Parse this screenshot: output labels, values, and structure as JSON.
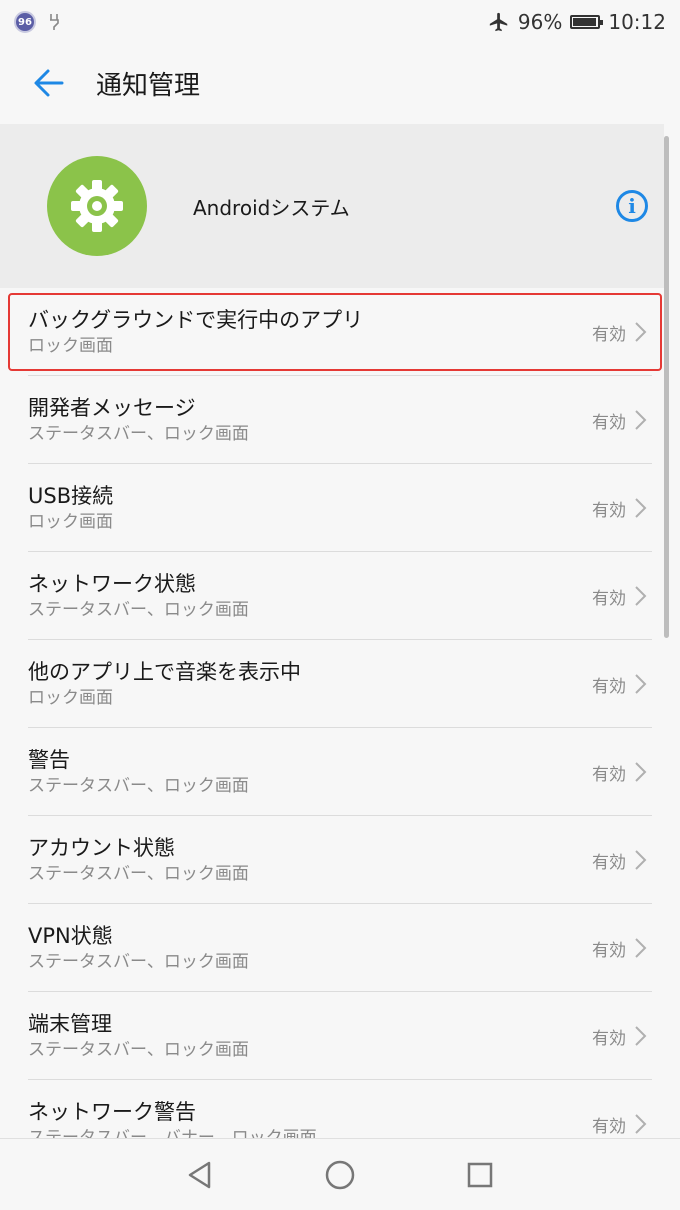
{
  "status_bar": {
    "notification_count": "96",
    "battery_text": "96%",
    "battery_level": 0.96,
    "time": "10:12"
  },
  "app_bar": {
    "title": "通知管理"
  },
  "app_header": {
    "name": "Androidシステム",
    "icon_color": "#8bc34a"
  },
  "list": {
    "items": [
      {
        "title": "バックグラウンドで実行中のアプリ",
        "subtitle": "ロック画面",
        "value": "有効",
        "highlighted": true
      },
      {
        "title": "開発者メッセージ",
        "subtitle": "ステータスバー、ロック画面",
        "value": "有効"
      },
      {
        "title": "USB接続",
        "subtitle": "ロック画面",
        "value": "有効"
      },
      {
        "title": "ネットワーク状態",
        "subtitle": "ステータスバー、ロック画面",
        "value": "有効"
      },
      {
        "title": "他のアプリ上で音楽を表示中",
        "subtitle": "ロック画面",
        "value": "有効"
      },
      {
        "title": "警告",
        "subtitle": "ステータスバー、ロック画面",
        "value": "有効"
      },
      {
        "title": "アカウント状態",
        "subtitle": "ステータスバー、ロック画面",
        "value": "有効"
      },
      {
        "title": "VPN状態",
        "subtitle": "ステータスバー、ロック画面",
        "value": "有効"
      },
      {
        "title": "端末管理",
        "subtitle": "ステータスバー、ロック画面",
        "value": "有効"
      },
      {
        "title": "ネットワーク警告",
        "subtitle": "ステータスバー、バナー、ロック画面",
        "value": "有効"
      }
    ]
  },
  "colors": {
    "accent": "#1e88e5",
    "highlight_border": "#e53935"
  },
  "icons": [
    "airplane-icon",
    "battery-icon",
    "back-arrow-icon",
    "gear-icon",
    "info-icon",
    "chevron-right-icon",
    "nav-back-icon",
    "nav-home-icon",
    "nav-recents-icon"
  ]
}
